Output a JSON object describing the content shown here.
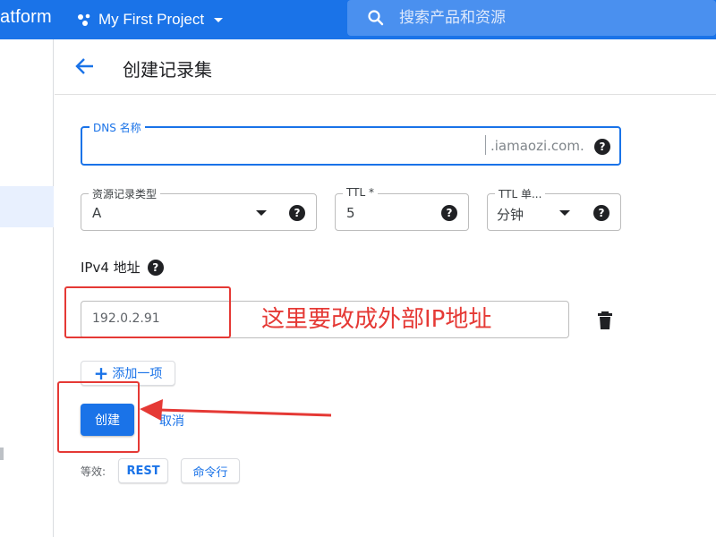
{
  "topbar": {
    "brand_fragment": "atform",
    "project_name": "My First Project",
    "search_placeholder": "搜索产品和资源",
    "color": "#1a73e8"
  },
  "page": {
    "title": "创建记录集",
    "back_icon": "arrow-left-icon"
  },
  "form": {
    "dns_name": {
      "label": "DNS 名称",
      "value": "",
      "suffix": ".iamaozi.com."
    },
    "record_type": {
      "label": "资源记录类型",
      "value": "A"
    },
    "ttl": {
      "label": "TTL *",
      "value": "5"
    },
    "ttl_unit": {
      "label": "TTL 单...",
      "value": "分钟"
    },
    "ipv4": {
      "label": "IPv4 地址",
      "value": "192.0.2.91"
    },
    "add_item_label": "添加一项",
    "create_label": "创建",
    "cancel_label": "取消",
    "equivalent_label": "等效:",
    "rest_label": "REST",
    "cli_label": "命令行"
  },
  "annotation": {
    "text": "这里要改成外部IP地址",
    "color": "#e53935"
  }
}
